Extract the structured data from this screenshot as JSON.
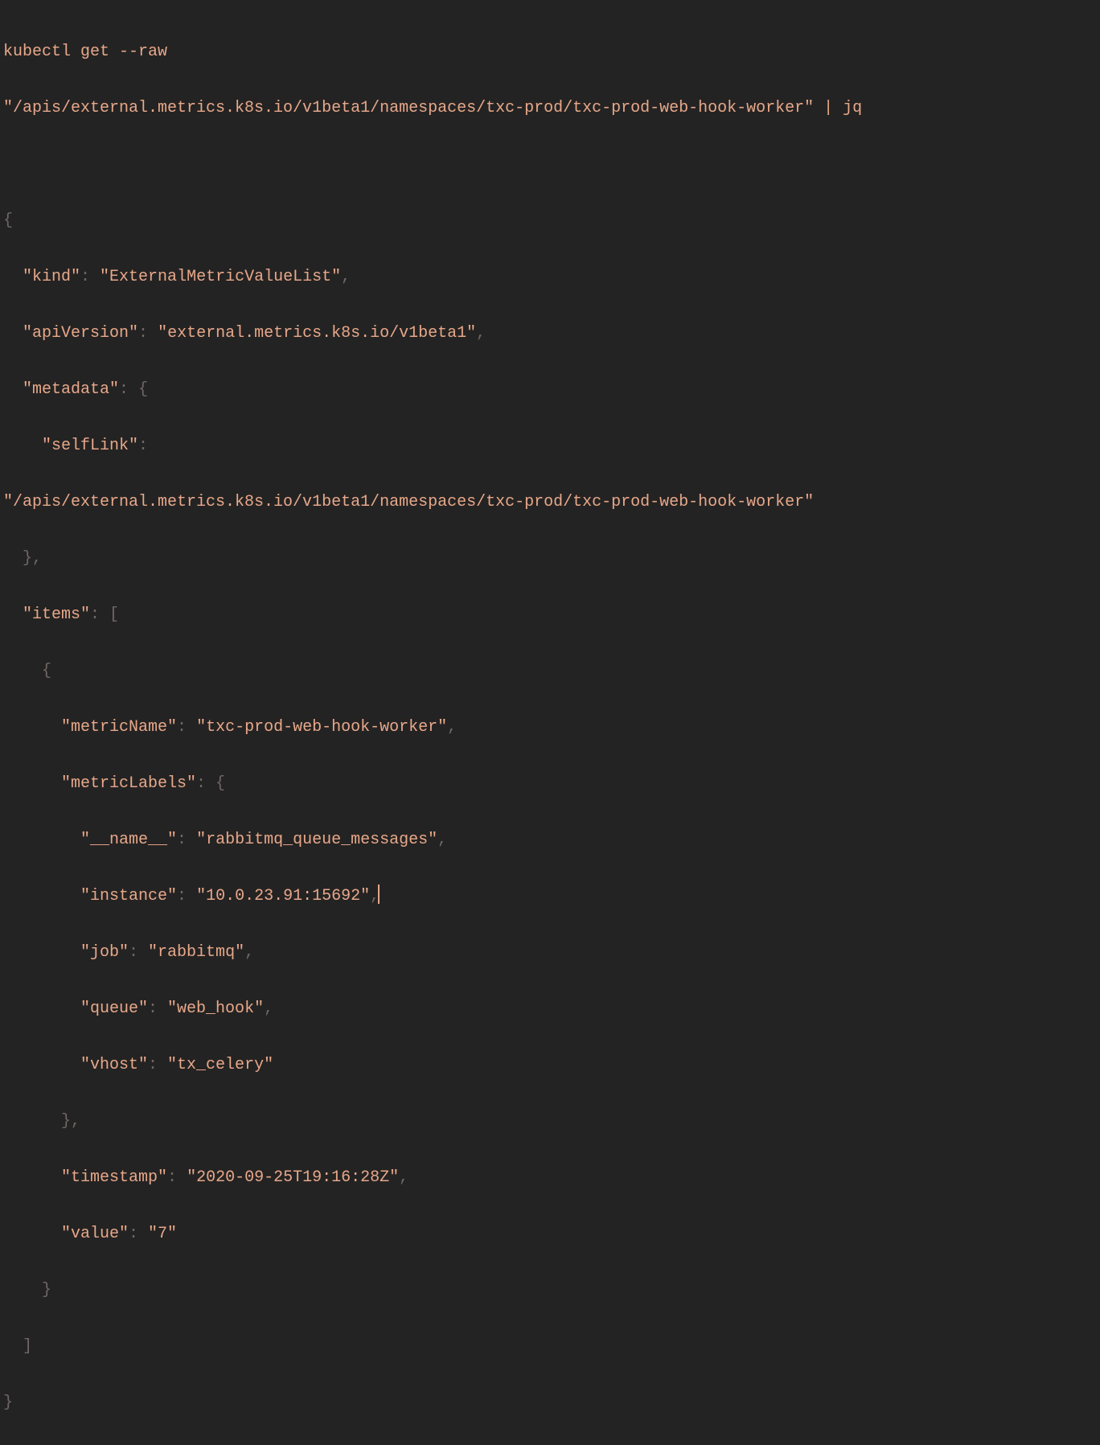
{
  "command": {
    "line1": "kubectl get --raw",
    "line2": "\"/apis/external.metrics.k8s.io/v1beta1/namespaces/txc-prod/txc-prod-web-hook-worker\" | jq"
  },
  "output": {
    "kind_key": "\"kind\"",
    "kind_val": "\"ExternalMetricValueList\"",
    "apiVersion_key": "\"apiVersion\"",
    "apiVersion_val": "\"external.metrics.k8s.io/v1beta1\"",
    "metadata_key": "\"metadata\"",
    "selfLink_key": "\"selfLink\"",
    "selfLink_val": "\"/apis/external.metrics.k8s.io/v1beta1/namespaces/txc-prod/txc-prod-web-hook-worker\"",
    "items_key": "\"items\"",
    "metricName_key": "\"metricName\"",
    "metricName_val": "\"txc-prod-web-hook-worker\"",
    "metricLabels_key": "\"metricLabels\"",
    "name_key": "\"__name__\"",
    "name_val": "\"rabbitmq_queue_messages\"",
    "instance_key": "\"instance\"",
    "instance_val": "\"10.0.23.91:15692\"",
    "job_key": "\"job\"",
    "job_val": "\"rabbitmq\"",
    "queue_key": "\"queue\"",
    "queue_val": "\"web_hook\"",
    "vhost_key": "\"vhost\"",
    "vhost_val": "\"tx_celery\"",
    "timestamp_key": "\"timestamp\"",
    "timestamp_val": "\"2020-09-25T19:16:28Z\"",
    "value_key": "\"value\"",
    "value_val": "\"7\""
  }
}
